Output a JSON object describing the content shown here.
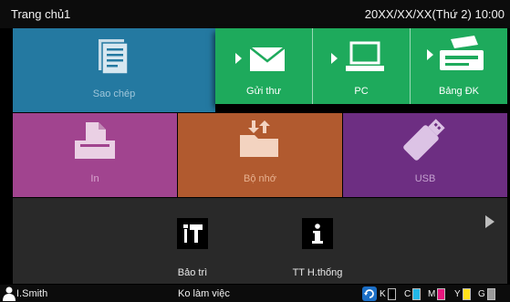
{
  "header": {
    "title": "Trang chủ1",
    "datetime": "20XX/XX/XX(Thứ 2) 10:00"
  },
  "tiles": {
    "copy": {
      "label": "Sao chép",
      "icon": "document-icon",
      "color": "#2479a1"
    },
    "email": {
      "label": "Gửi thư",
      "icon": "envelope-icon"
    },
    "pc": {
      "label": "PC",
      "icon": "computer-icon"
    },
    "console": {
      "label": "Bảng ĐK",
      "icon": "scanner-console-icon"
    },
    "send_color": "#1eaa5c",
    "print": {
      "label": "In",
      "icon": "printer-icon",
      "color": "#a1448f"
    },
    "memory": {
      "label": "Bộ nhớ",
      "icon": "folder-transfer-icon",
      "color": "#b15a2f"
    },
    "usb": {
      "label": "USB",
      "icon": "usb-drive-icon",
      "color": "#6d2e82"
    }
  },
  "tools": {
    "maintenance": {
      "label": "Bảo trì",
      "icon": "tools-icon"
    },
    "system_info": {
      "label": "TT H.thống",
      "icon": "info-icon"
    }
  },
  "status": {
    "user": "I.Smith",
    "state": "Ko làm việc",
    "inks": [
      {
        "label": "K",
        "color": "#000000"
      },
      {
        "label": "C",
        "color": "#22b7e8"
      },
      {
        "label": "M",
        "color": "#e6177e"
      },
      {
        "label": "Y",
        "color": "#ffe21a"
      },
      {
        "label": "G",
        "color": "#9a9a9a"
      }
    ]
  }
}
